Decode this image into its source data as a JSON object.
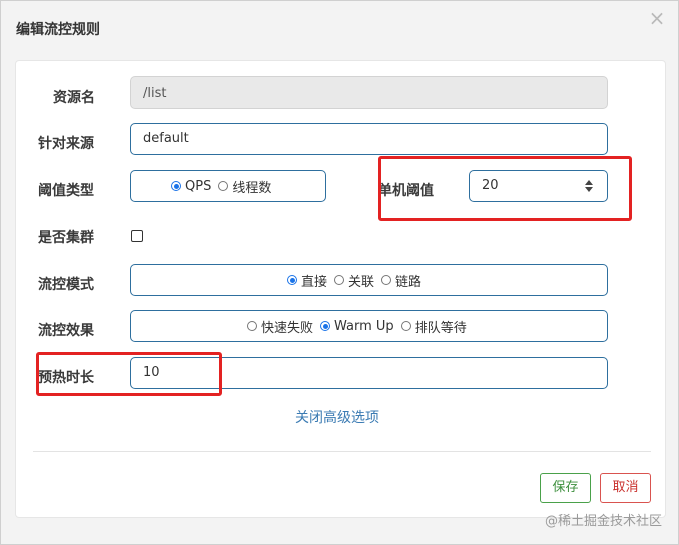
{
  "dialog": {
    "title": "编辑流控规则",
    "close_symbol": "×"
  },
  "form": {
    "resource": {
      "label": "资源名",
      "value": "/list"
    },
    "limit_app": {
      "label": "针对来源",
      "value": "default"
    },
    "grade": {
      "label": "阈值类型",
      "options": [
        {
          "label": "QPS",
          "checked": true
        },
        {
          "label": "线程数",
          "checked": false
        }
      ]
    },
    "threshold": {
      "label": "单机阈值",
      "value": "20"
    },
    "cluster": {
      "label": "是否集群",
      "checked": false
    },
    "strategy": {
      "label": "流控模式",
      "options": [
        {
          "label": "直接",
          "checked": true
        },
        {
          "label": "关联",
          "checked": false
        },
        {
          "label": "链路",
          "checked": false
        }
      ]
    },
    "control_behavior": {
      "label": "流控效果",
      "options": [
        {
          "label": "快速失败",
          "checked": false
        },
        {
          "label": "Warm Up",
          "checked": true
        },
        {
          "label": "排队等待",
          "checked": false
        }
      ]
    },
    "warmup": {
      "label": "预热时长",
      "value": "10"
    },
    "advanced_link": "关闭高级选项"
  },
  "footer": {
    "save_label": "保存",
    "cancel_label": "取消"
  },
  "watermark": "@稀土掘金技术社区",
  "colors": {
    "highlight": "#e32222",
    "accent": "#1a73e8",
    "link": "#3b7bb3"
  }
}
